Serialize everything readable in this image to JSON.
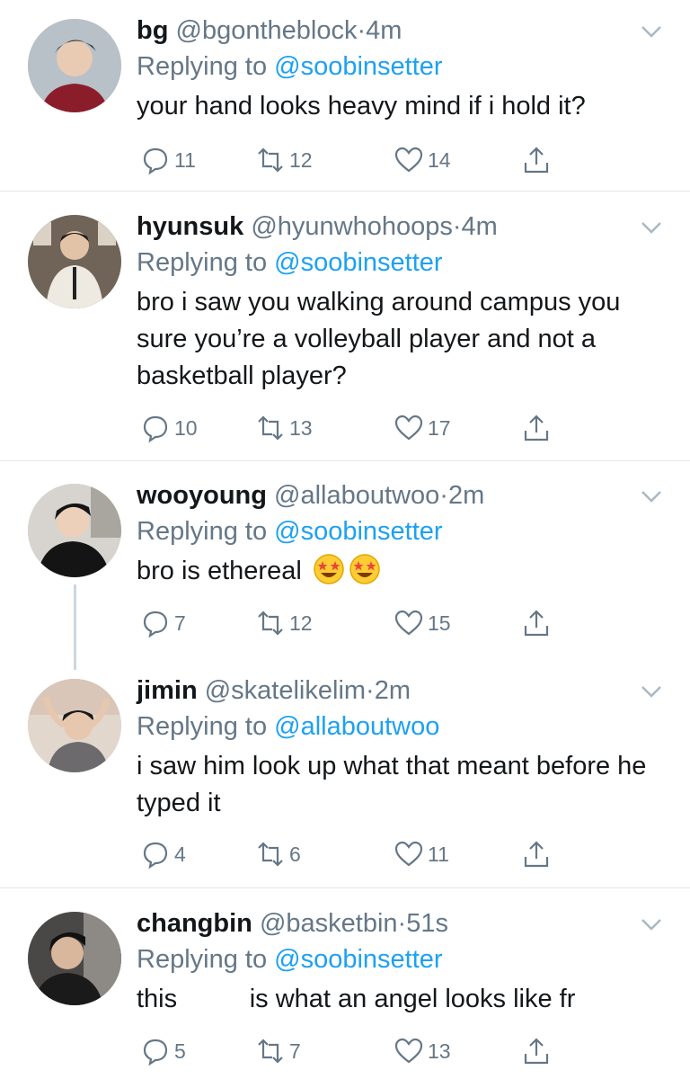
{
  "tweets": [
    {
      "name": "bg",
      "handle": "@bgontheblock",
      "time": "4m",
      "replying_to_prefix": "Replying to ",
      "replying_to": "@soobinsetter",
      "body": "your hand looks heavy mind if i hold it?",
      "replies": "11",
      "retweets": "12",
      "likes": "14"
    },
    {
      "name": "hyunsuk",
      "handle": "@hyunwhohoops",
      "time": "4m",
      "replying_to_prefix": "Replying to ",
      "replying_to": "@soobinsetter",
      "body": "bro i saw you walking around campus you sure you’re a volleyball player and not a basketball player?",
      "replies": "10",
      "retweets": "13",
      "likes": "17"
    },
    {
      "name": "wooyoung",
      "handle": "@allaboutwoo",
      "time": "2m",
      "replying_to_prefix": "Replying to ",
      "replying_to": "@soobinsetter",
      "body": "bro is ethereal",
      "replies": "7",
      "retweets": "12",
      "likes": "15"
    },
    {
      "name": "jimin",
      "handle": "@skatelikelim",
      "time": "2m",
      "replying_to_prefix": "Replying to ",
      "replying_to": "@allaboutwoo",
      "body": "i saw him look up what that meant before he typed it",
      "replies": "4",
      "retweets": "6",
      "likes": "11"
    },
    {
      "name": "changbin",
      "handle": "@basketbin",
      "time": "51s",
      "replying_to_prefix": "Replying to ",
      "replying_to": "@soobinsetter",
      "body": "this          is what an angel looks like fr",
      "replies": "5",
      "retweets": "7",
      "likes": "13"
    }
  ],
  "icons": {
    "reply": "reply-icon",
    "retweet": "retweet-icon",
    "like": "heart-icon",
    "share": "share-icon",
    "more": "chevron-down-icon",
    "emoji": "star-struck-emoji"
  },
  "colors": {
    "mention": "#1da1f2",
    "secondary": "#657786",
    "text": "#14171a",
    "separator": "#e1e8ed"
  }
}
